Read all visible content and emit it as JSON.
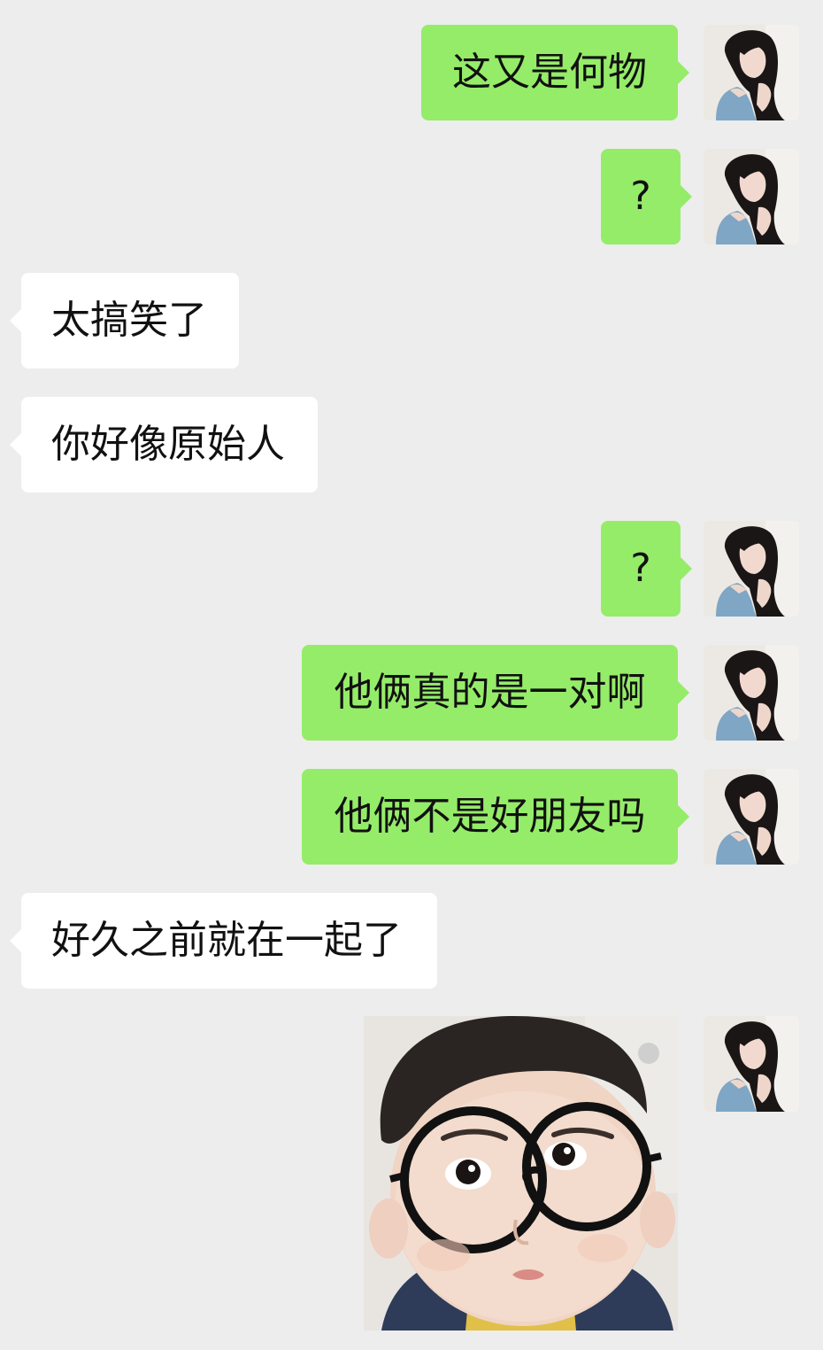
{
  "chat": {
    "messages": [
      {
        "id": "m1",
        "side": "outgoing",
        "text": "这又是何物"
      },
      {
        "id": "m2",
        "side": "outgoing",
        "text": "?"
      },
      {
        "id": "m3",
        "side": "incoming",
        "text": "太搞笑了"
      },
      {
        "id": "m4",
        "side": "incoming",
        "text": "你好像原始人"
      },
      {
        "id": "m5",
        "side": "outgoing",
        "text": "?"
      },
      {
        "id": "m6",
        "side": "outgoing",
        "text": "他俩真的是一对啊"
      },
      {
        "id": "m7",
        "side": "outgoing",
        "text": "他俩不是好朋友吗"
      },
      {
        "id": "m8",
        "side": "incoming",
        "text": "好久之前就在一起了"
      },
      {
        "id": "m9",
        "side": "outgoing",
        "type": "sticker",
        "sticker": "boy-with-round-glasses"
      }
    ]
  },
  "colors": {
    "background": "#ededed",
    "outgoing_bubble": "#95ec69",
    "incoming_bubble": "#ffffff",
    "text": "#111111"
  }
}
